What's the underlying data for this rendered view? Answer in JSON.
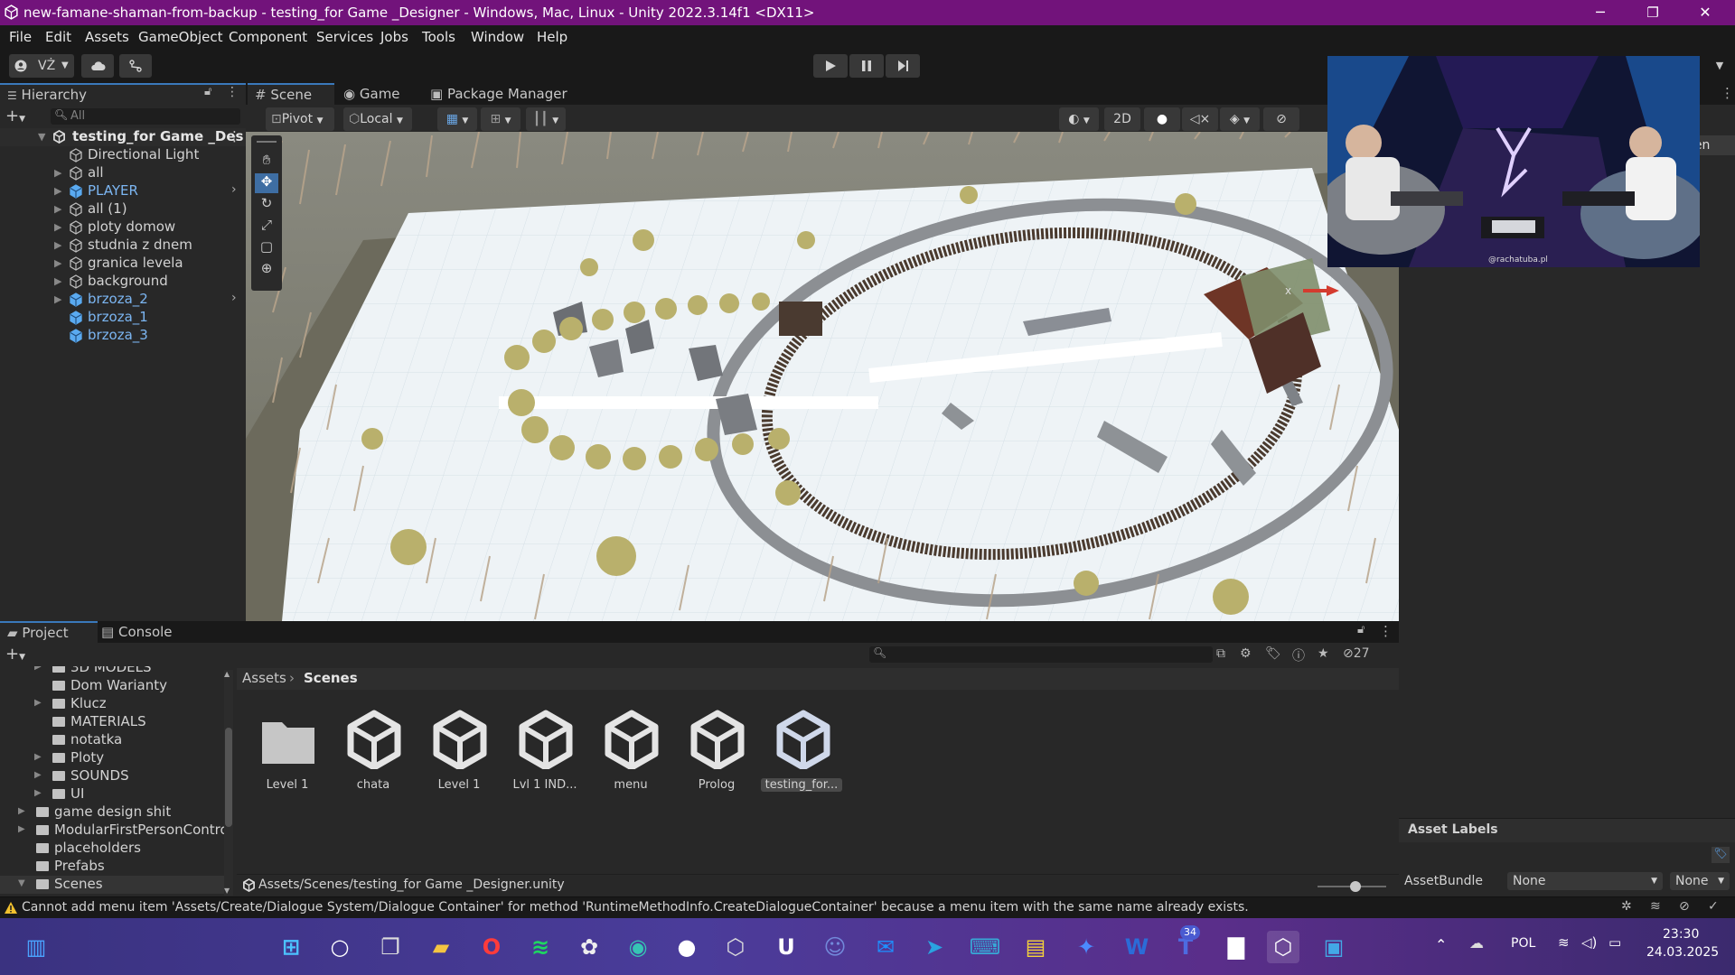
{
  "window": {
    "title": "new-famane-shaman-from-backup - testing_for Game _Designer - Windows, Mac, Linux - Unity 2022.3.14f1 <DX11>",
    "controls": [
      "─",
      "❐",
      "✕"
    ]
  },
  "menu": [
    "File",
    "Edit",
    "Assets",
    "GameObject",
    "Component",
    "Services",
    "Jobs",
    "Tools",
    "Window",
    "Help"
  ],
  "toolbar": {
    "account": "VŻ",
    "play_icon": "play-icon",
    "pause_icon": "pause-icon",
    "step_icon": "step-icon"
  },
  "hierarchy": {
    "tab": "Hierarchy",
    "search_placeholder": "All",
    "scene": "testing_for Game _Des",
    "items": [
      {
        "label": "Directional Light",
        "kind": "object"
      },
      {
        "label": "all",
        "kind": "object"
      },
      {
        "label": "PLAYER",
        "kind": "prefab"
      },
      {
        "label": "all (1)",
        "kind": "object"
      },
      {
        "label": "ploty domow",
        "kind": "object"
      },
      {
        "label": "studnia z dnem",
        "kind": "object"
      },
      {
        "label": "granica levela",
        "kind": "object"
      },
      {
        "label": "background",
        "kind": "object"
      },
      {
        "label": "brzoza_2",
        "kind": "prefab"
      },
      {
        "label": "brzoza_1",
        "kind": "prefab"
      },
      {
        "label": "brzoza_3",
        "kind": "prefab"
      }
    ]
  },
  "scene_view": {
    "tabs": [
      "Scene",
      "Game",
      "Package Manager"
    ],
    "pivot": "Pivot",
    "space": "Local",
    "mode_2d": "2D",
    "axis_x": "x"
  },
  "inspector": {
    "open_label": "pen",
    "asset_labels": "Asset Labels",
    "assetbundle_label": "AssetBundle",
    "assetbundle_value": "None",
    "variant_value": "None"
  },
  "project": {
    "tabs": [
      "Project",
      "Console"
    ],
    "hidden_count": "27",
    "breadcrumb": [
      "Assets",
      "Scenes"
    ],
    "tree": [
      {
        "label": "3D MODELS",
        "depth": 1,
        "arrow": true
      },
      {
        "label": "Dom Warianty",
        "depth": 1,
        "arrow": false
      },
      {
        "label": "Klucz",
        "depth": 1,
        "arrow": true
      },
      {
        "label": "MATERIALS",
        "depth": 1,
        "arrow": false
      },
      {
        "label": "notatka",
        "depth": 1,
        "arrow": false
      },
      {
        "label": "Ploty",
        "depth": 1,
        "arrow": true
      },
      {
        "label": "SOUNDS",
        "depth": 1,
        "arrow": true
      },
      {
        "label": "UI",
        "depth": 1,
        "arrow": true
      },
      {
        "label": "game design shit",
        "depth": 0,
        "arrow": true
      },
      {
        "label": "ModularFirstPersonContro",
        "depth": 0,
        "arrow": true
      },
      {
        "label": "placeholders",
        "depth": 0,
        "arrow": false
      },
      {
        "label": "Prefabs",
        "depth": 0,
        "arrow": false
      },
      {
        "label": "Scenes",
        "depth": 0,
        "arrow": true
      }
    ],
    "assets": [
      {
        "name": "Level 1",
        "type": "folder"
      },
      {
        "name": "chata",
        "type": "scene"
      },
      {
        "name": "Level 1",
        "type": "scene"
      },
      {
        "name": "Lvl 1 IND...",
        "type": "scene"
      },
      {
        "name": "menu",
        "type": "scene"
      },
      {
        "name": "Prolog",
        "type": "scene"
      },
      {
        "name": "testing_for...",
        "type": "scene"
      }
    ],
    "status_path": "Assets/Scenes/testing_for Game _Designer.unity",
    "zoom": 0.55
  },
  "console_message": "Cannot add menu item 'Assets/Create/Dialogue System/Dialogue Container' for method 'RuntimeMethodInfo.CreateDialogueContainer' because a menu item with the same name already exists.",
  "webcam": {
    "overlay_text": "@rachatuba.pl"
  },
  "taskbar": {
    "icons": [
      "widgets-icon",
      "start-icon",
      "search-icon",
      "task-view-icon",
      "file-explorer-icon",
      "opera-icon",
      "spotify-icon",
      "chatgpt-icon",
      "app-icon",
      "github-icon",
      "unity-hub-icon",
      "unreal-icon",
      "discord-icon",
      "outlook-icon",
      "telegram-icon",
      "keyboard-app-icon",
      "sticky-notes-icon",
      "messenger-icon",
      "word-icon",
      "teams-icon",
      "chart-app-icon",
      "unity-icon",
      "photos-icon"
    ],
    "badge": "34",
    "language": "POL",
    "time": "23:30",
    "date": "24.03.2025"
  }
}
